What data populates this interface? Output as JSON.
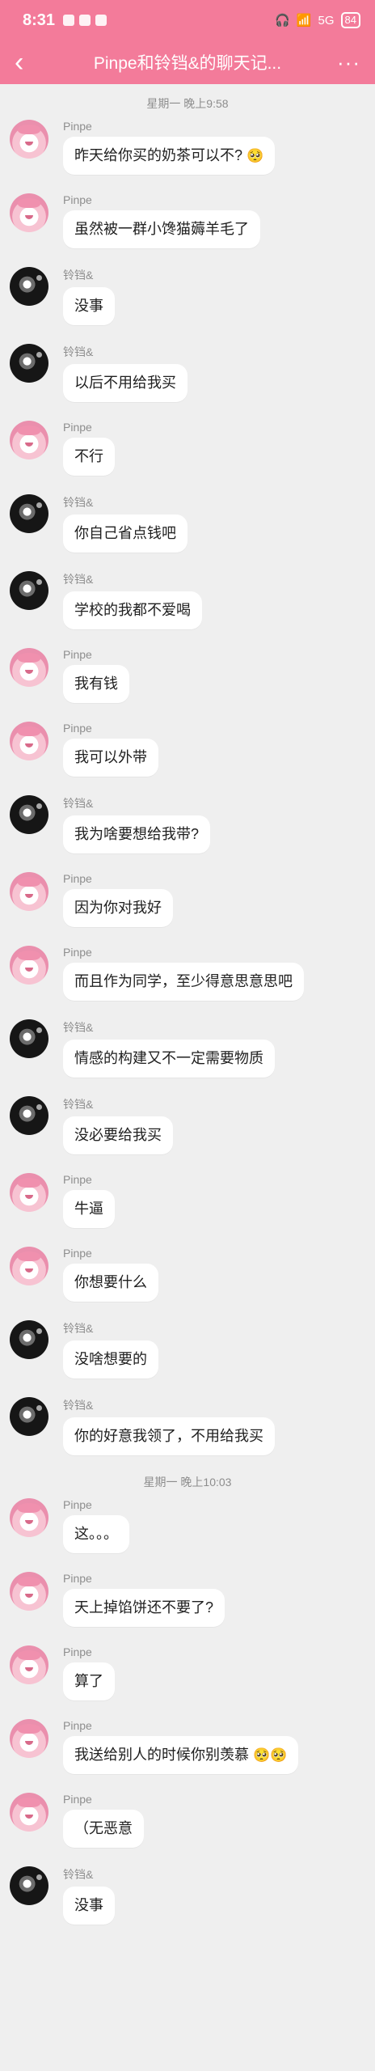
{
  "status": {
    "time": "8:31",
    "right_text": "5G",
    "battery": "84"
  },
  "header": {
    "back_icon": "‹",
    "title": "Pinpe和铃铛&的聊天记...",
    "more_icon": "···"
  },
  "timestamps": [
    "星期一 晚上9:58",
    "星期一 晚上10:03"
  ],
  "contacts": {
    "pinpe": "Pinpe",
    "ling": "铃铛&"
  },
  "messages": [
    {
      "text": "昨天给你买的奶茶可以不?"
    },
    {
      "text": "虽然被一群小馋猫薅羊毛了"
    },
    {
      "text": "没事"
    },
    {
      "text": "以后不用给我买"
    },
    {
      "text": "不行"
    },
    {
      "text": "你自己省点钱吧"
    },
    {
      "text": "学校的我都不爱喝"
    },
    {
      "text": "我有钱"
    },
    {
      "text": "我可以外带"
    },
    {
      "text": "我为啥要想给我带?"
    },
    {
      "text": "因为你对我好"
    },
    {
      "text": "而且作为同学，至少得意思意思吧"
    },
    {
      "text": "情感的构建又不一定需要物质"
    },
    {
      "text": "没必要给我买"
    },
    {
      "text": "牛逼"
    },
    {
      "text": "你想要什么"
    },
    {
      "text": "没啥想要的"
    },
    {
      "text": "你的好意我领了，不用给我买"
    },
    {
      "text": "这。。。"
    },
    {
      "text": "天上掉馅饼还不要了?"
    },
    {
      "text": "算了"
    },
    {
      "text": "我送给别人的时候你别羡慕"
    },
    {
      "text": "（无恶意"
    },
    {
      "text": "没事"
    }
  ],
  "icons": {
    "emoji1": "🥺",
    "emoji2": "🥺🥺"
  },
  "colors": {
    "header": "#f37b9a",
    "background": "#efefef",
    "bubble": "#ffffff"
  }
}
